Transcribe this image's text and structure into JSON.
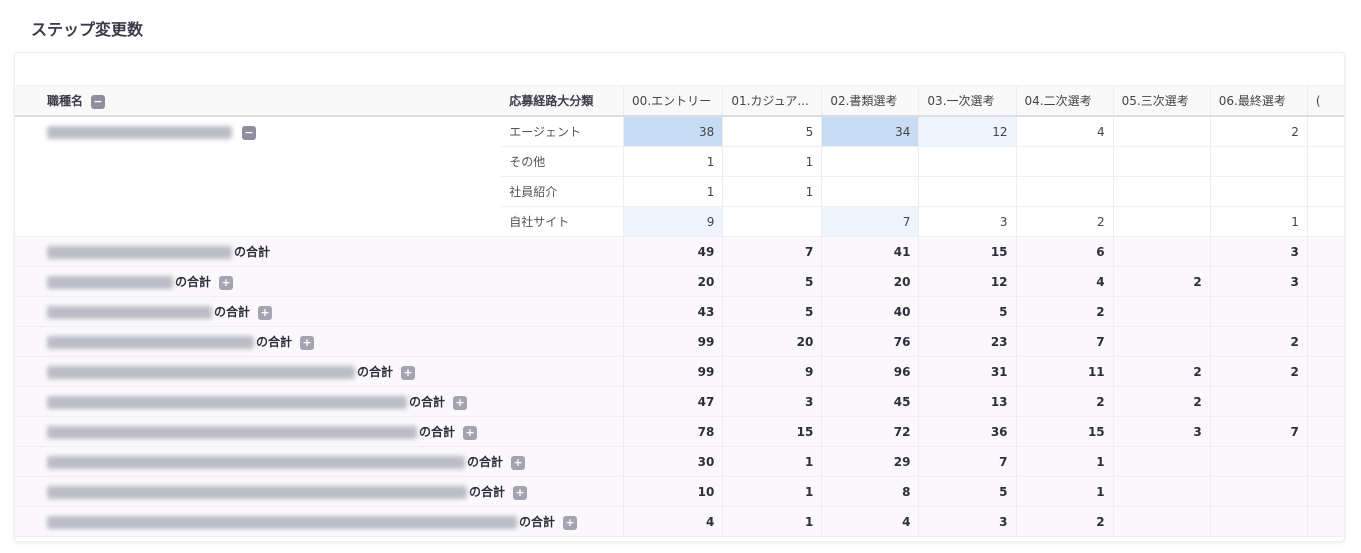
{
  "page": {
    "title": "ステップ変更数"
  },
  "headers": {
    "job": "職種名",
    "route": "応募経路大分類",
    "steps": [
      "00.エントリー",
      "01.カジュア...",
      "02.書類選考",
      "03.一次選考",
      "04.二次選考",
      "05.三次選考",
      "06.最終選考",
      "("
    ]
  },
  "detail_rows": [
    {
      "route": "エージェント",
      "values": [
        "38",
        "5",
        "34",
        "12",
        "4",
        "",
        "2",
        ""
      ]
    },
    {
      "route": "その他",
      "values": [
        "1",
        "1",
        "",
        "",
        "",
        "",
        "",
        ""
      ]
    },
    {
      "route": "社員紹介",
      "values": [
        "1",
        "1",
        "",
        "",
        "",
        "",
        "",
        ""
      ]
    },
    {
      "route": "自社サイト",
      "values": [
        "9",
        "",
        "7",
        "3",
        "2",
        "",
        "1",
        ""
      ]
    }
  ],
  "sum_rows": [
    {
      "suffix": "の合計",
      "values": [
        "49",
        "7",
        "41",
        "15",
        "6",
        "",
        "3",
        ""
      ]
    },
    {
      "suffix": "の合計",
      "values": [
        "20",
        "5",
        "20",
        "12",
        "4",
        "2",
        "3",
        ""
      ]
    },
    {
      "suffix": "の合計",
      "values": [
        "43",
        "5",
        "40",
        "5",
        "2",
        "",
        "",
        ""
      ]
    },
    {
      "suffix": "の合計",
      "values": [
        "99",
        "20",
        "76",
        "23",
        "7",
        "",
        "2",
        ""
      ]
    },
    {
      "suffix": "の合計",
      "values": [
        "99",
        "9",
        "96",
        "31",
        "11",
        "2",
        "2",
        ""
      ]
    },
    {
      "suffix": "の合計",
      "values": [
        "47",
        "3",
        "45",
        "13",
        "2",
        "2",
        "",
        ""
      ]
    },
    {
      "suffix": "の合計",
      "values": [
        "78",
        "15",
        "72",
        "36",
        "15",
        "3",
        "7",
        ""
      ]
    },
    {
      "suffix": "の合計",
      "values": [
        "30",
        "1",
        "29",
        "7",
        "1",
        "",
        "",
        ""
      ]
    },
    {
      "suffix": "の合計",
      "values": [
        "10",
        "1",
        "8",
        "5",
        "1",
        "",
        "",
        ""
      ]
    },
    {
      "suffix": "の合計",
      "values": [
        "4",
        "1",
        "4",
        "3",
        "2",
        "",
        "",
        ""
      ]
    }
  ],
  "icons": {
    "collapse": "minus-icon",
    "expand": "plus-icon"
  },
  "colors": {
    "highlight_strong": "#c7dcf3",
    "highlight_light": "#eef4fc"
  }
}
